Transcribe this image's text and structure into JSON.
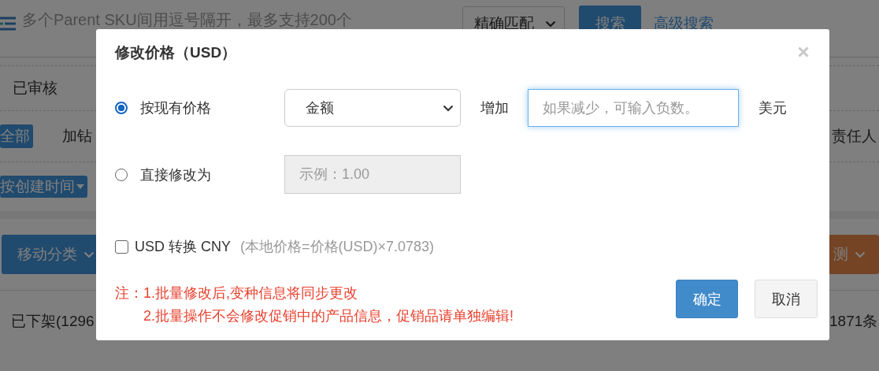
{
  "background": {
    "search": {
      "placeholder": "多个Parent SKU间用逗号隔开，最多支持200个"
    },
    "match_select": {
      "value": "精确匹配"
    },
    "search_button": "搜索",
    "advanced_search_link": "高级搜索",
    "status_label": "已审核",
    "tags": [
      {
        "label": "全部",
        "selected": true
      },
      {
        "label": "加钻",
        "selected": false
      }
    ],
    "column_label": "责任人",
    "sort_button": "按创建时间",
    "move_category_button": "移动分类",
    "detect_button": "测",
    "tab_label": "已下架(1296",
    "total": "1871条"
  },
  "dialog": {
    "title": "修改价格（USD）",
    "options": [
      {
        "kind": "adjust",
        "label": "按现有价格",
        "selected": true,
        "select": {
          "value": "金额"
        },
        "operation": "增加",
        "input": {
          "placeholder": "如果减少，可输入负数。"
        },
        "unit": "美元"
      },
      {
        "kind": "direct",
        "label": "直接修改为",
        "selected": false,
        "input": {
          "placeholder": "示例：1.00"
        }
      }
    ],
    "convert": {
      "checked": false,
      "label": "USD 转换 CNY",
      "hint": "(本地价格=价格(USD)×7.0783)"
    },
    "note": {
      "prefix": "注：",
      "lines": [
        "1.批量修改后,变种信息将同步更改",
        "2.批量操作不会修改促销中的产品信息，促销品请单独编辑!"
      ]
    },
    "buttons": [
      {
        "kind": "primary",
        "label": "确定"
      },
      {
        "kind": "default",
        "label": "取消"
      }
    ]
  }
}
